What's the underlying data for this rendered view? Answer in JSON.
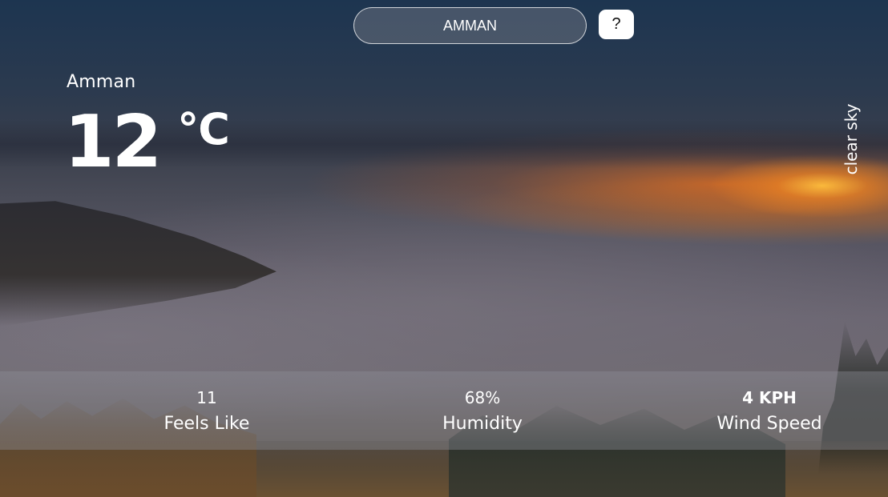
{
  "search": {
    "value": "AMMAN",
    "help_label": "?"
  },
  "current": {
    "city": "Amman",
    "temperature": "12",
    "unit": "°C",
    "condition": "clear sky"
  },
  "stats": {
    "feels_like": {
      "value": "11",
      "label": "Feels Like"
    },
    "humidity": {
      "value": "68%",
      "label": "Humidity"
    },
    "wind": {
      "value": "4 KPH",
      "label": "Wind Speed"
    }
  },
  "background": {
    "description_colors": {
      "sky_top": "#1d3550",
      "sunset": "#e66e1e",
      "fog": "#6b6672",
      "ground": "#6a5132"
    }
  }
}
